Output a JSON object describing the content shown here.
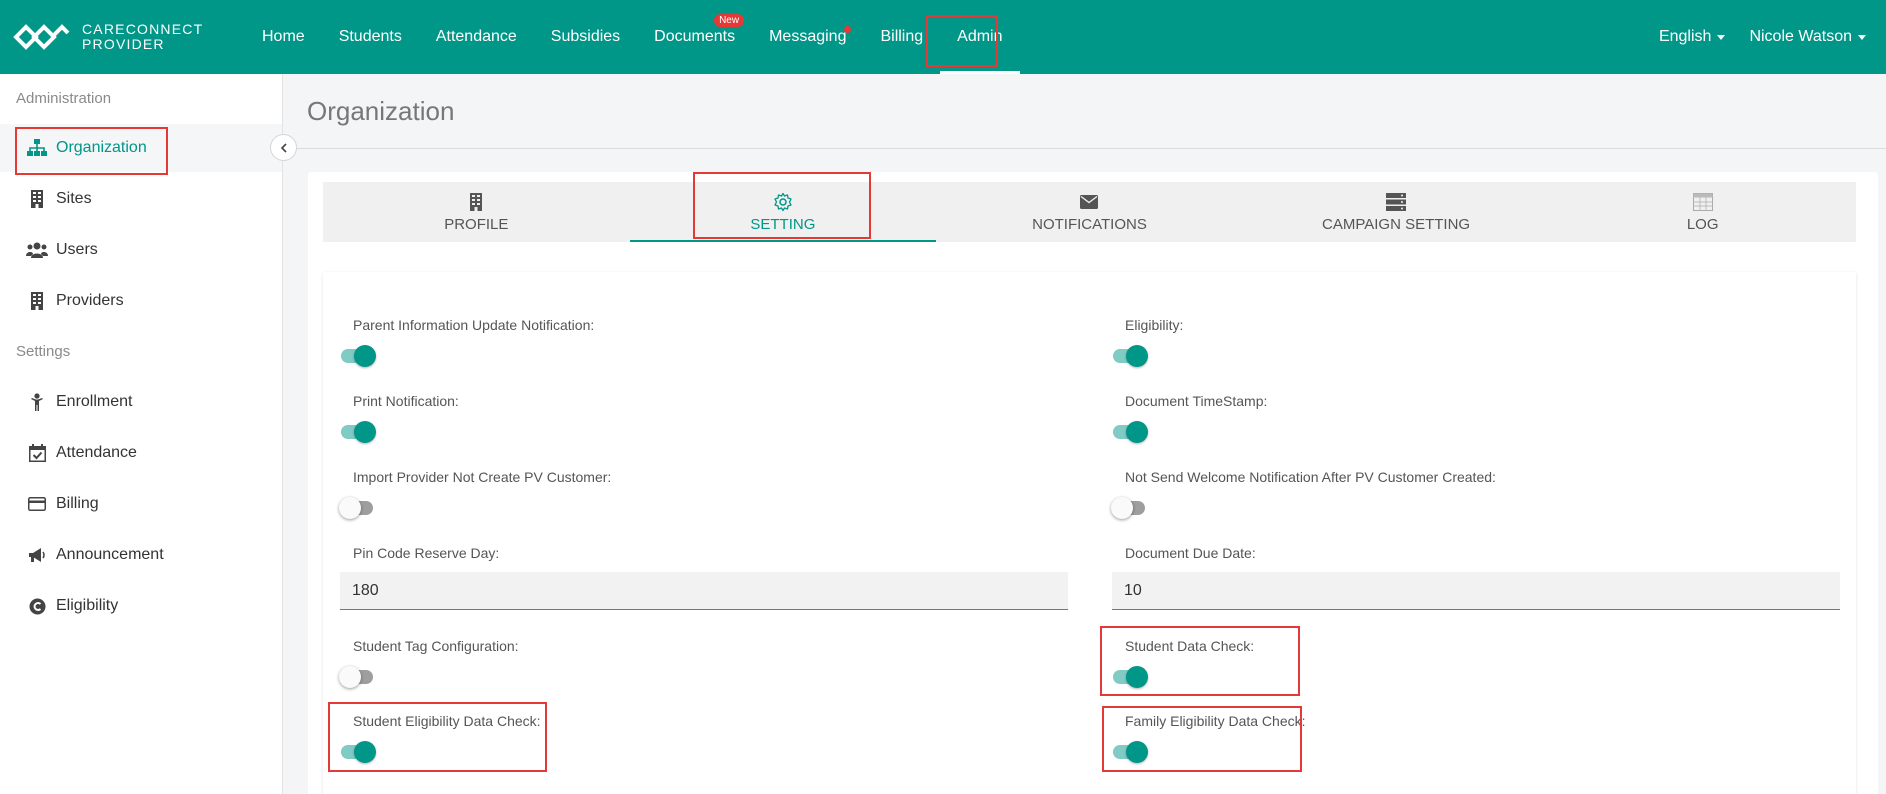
{
  "brand": {
    "line1": "CARECONNECT",
    "line2": "PROVIDER"
  },
  "nav": {
    "items": [
      {
        "label": "Home"
      },
      {
        "label": "Students"
      },
      {
        "label": "Attendance"
      },
      {
        "label": "Subsidies"
      },
      {
        "label": "Documents",
        "badge": "New"
      },
      {
        "label": "Messaging"
      },
      {
        "label": "Billing"
      },
      {
        "label": "Admin",
        "active": true
      }
    ],
    "language": "English",
    "user": "Nicole Watson"
  },
  "sidebar": {
    "section_admin": "Administration",
    "admin_items": [
      {
        "label": "Organization",
        "icon": "sitemap-icon",
        "active": true
      },
      {
        "label": "Sites",
        "icon": "building-icon"
      },
      {
        "label": "Users",
        "icon": "users-icon"
      },
      {
        "label": "Providers",
        "icon": "building-icon"
      }
    ],
    "section_settings": "Settings",
    "settings_items": [
      {
        "label": "Enrollment",
        "icon": "child-icon"
      },
      {
        "label": "Attendance",
        "icon": "calendar-check-icon"
      },
      {
        "label": "Billing",
        "icon": "credit-card-icon"
      },
      {
        "label": "Announcement",
        "icon": "megaphone-icon"
      },
      {
        "label": "Eligibility",
        "icon": "copyright-icon"
      }
    ]
  },
  "page": {
    "title": "Organization"
  },
  "tabs": [
    {
      "label": "PROFILE",
      "icon": "building-icon"
    },
    {
      "label": "SETTING",
      "icon": "gear-icon",
      "active": true
    },
    {
      "label": "NOTIFICATIONS",
      "icon": "envelope-icon"
    },
    {
      "label": "CAMPAIGN SETTING",
      "icon": "server-icon"
    },
    {
      "label": "LOG",
      "icon": "table-icon"
    }
  ],
  "settings": {
    "parent_info_update": {
      "label": "Parent Information Update Notification:",
      "on": true
    },
    "eligibility": {
      "label": "Eligibility:",
      "on": true
    },
    "print_notification": {
      "label": "Print Notification:",
      "on": true
    },
    "document_timestamp": {
      "label": "Document TimeStamp:",
      "on": true
    },
    "import_provider": {
      "label": "Import Provider Not Create PV Customer:",
      "on": false
    },
    "not_send_welcome": {
      "label": "Not Send Welcome Notification After PV Customer Created:",
      "on": false
    },
    "pin_code_reserve_day": {
      "label": "Pin Code Reserve Day:",
      "value": "180"
    },
    "document_due_date": {
      "label": "Document Due Date:",
      "value": "10"
    },
    "student_tag_config": {
      "label": "Student Tag Configuration:",
      "on": false
    },
    "student_data_check": {
      "label": "Student Data Check:",
      "on": true
    },
    "student_eligibility_check": {
      "label": "Student Eligibility Data Check:",
      "on": true
    },
    "family_eligibility_check": {
      "label": "Family Eligibility Data Check:",
      "on": true
    }
  },
  "colors": {
    "primary": "#009688",
    "highlight": "#e53935",
    "badge": "#e53935"
  }
}
